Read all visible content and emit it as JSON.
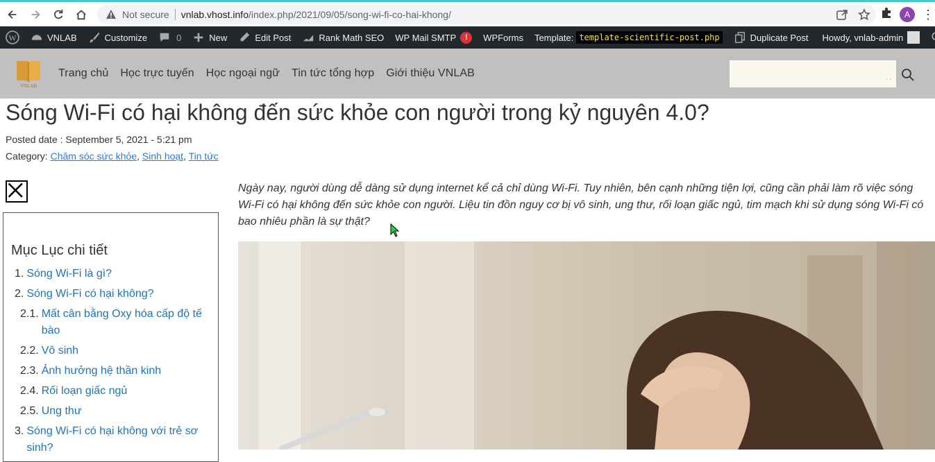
{
  "browser": {
    "not_secure": "Not secure",
    "url_host": "vnlab.vhost.info",
    "url_path": "/index.php/2021/09/05/song-wi-fi-co-hai-khong/",
    "profile_initial": "A"
  },
  "adminbar": {
    "site": "VNLAB",
    "customize": "Customize",
    "comments_count": "0",
    "new": "New",
    "edit_post": "Edit Post",
    "rank_math": "Rank Math SEO",
    "wp_mail": "WP Mail SMTP",
    "wp_mail_alert": "!",
    "wpforms": "WPForms",
    "template_label": "Template:",
    "template_file": "template-scientific-post.php",
    "duplicate": "Duplicate Post",
    "howdy": "Howdy, vnlab-admin"
  },
  "header": {
    "logo_text": "VNLAB",
    "nav": [
      "Trang chủ",
      "Học trực tuyến",
      "Học ngoại ngữ",
      "Tin tức tổng hợp",
      "Giới thiệu VNLAB"
    ],
    "search_value": ""
  },
  "post": {
    "title": "Sóng Wi-Fi có hại không đến sức khỏe con người trong kỷ nguyên 4.0?",
    "posted_date": "Posted date : September 5, 2021 - 5:21 pm",
    "category_label": "Category: ",
    "categories": [
      "Chăm sóc sức khỏe",
      "Sinh hoạt",
      "Tin tức"
    ],
    "intro": "Ngày nay, người dùng dễ dàng sử dụng internet kể cả chỉ dùng Wi-Fi. Tuy nhiên, bên cạnh những tiện lợi, cũng cần phải làm rõ việc sóng Wi-Fi có hại không đến sức khỏe con người. Liệu tin đồn nguy cơ bị vô sinh, ung thư, rối loạn giấc ngủ, tim mạch khi sử dụng sóng Wi-Fi có bao nhiêu phần là sự thật?"
  },
  "toc": {
    "title": "Mục Lục chi tiết",
    "items": [
      {
        "num": "1.",
        "text": "Sóng Wi-Fi là gì?"
      },
      {
        "num": "2.",
        "text": "Sóng Wi-Fi có hại không?"
      },
      {
        "num": "2.1.",
        "text": "Mất cân bằng Oxy hóa cấp độ tế bào"
      },
      {
        "num": "2.2.",
        "text": "Vô sinh"
      },
      {
        "num": "2.3.",
        "text": "Ảnh hưởng hệ thần kinh"
      },
      {
        "num": "2.4.",
        "text": "Rối loạn giấc ngủ"
      },
      {
        "num": "2.5.",
        "text": "Ung thư"
      },
      {
        "num": "3.",
        "text": "Sóng Wi-Fi có hại không với trẻ sơ sinh?"
      }
    ]
  }
}
